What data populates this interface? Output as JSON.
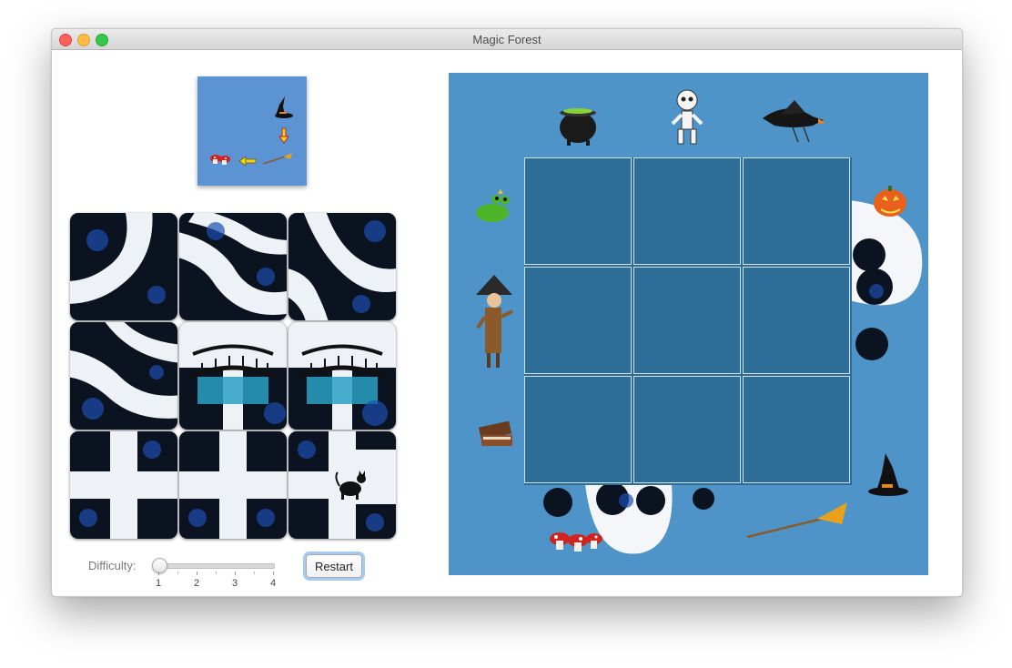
{
  "window": {
    "title": "Magic Forest"
  },
  "controls": {
    "difficulty_label": "Difficulty:",
    "difficulty_value": 1,
    "difficulty_ticks": [
      "1",
      "2",
      "3",
      "4"
    ],
    "restart_label": "Restart"
  },
  "preview": {
    "icons": [
      "witch-hat-icon",
      "arrow-down-icon",
      "broom-icon",
      "arrow-left-icon",
      "mushrooms-icon"
    ]
  },
  "tiles": [
    {
      "row": 1,
      "col": 1,
      "icon": "forest-path-tile"
    },
    {
      "row": 1,
      "col": 2,
      "icon": "forest-path-tile"
    },
    {
      "row": 1,
      "col": 3,
      "icon": "forest-path-tile"
    },
    {
      "row": 2,
      "col": 1,
      "icon": "forest-path-tile"
    },
    {
      "row": 2,
      "col": 2,
      "icon": "bridge-tile"
    },
    {
      "row": 2,
      "col": 3,
      "icon": "bridge-tile"
    },
    {
      "row": 3,
      "col": 1,
      "icon": "crossroad-tile"
    },
    {
      "row": 3,
      "col": 2,
      "icon": "crossroad-tile"
    },
    {
      "row": 3,
      "col": 3,
      "icon": "black-cat-tile"
    }
  ],
  "board": {
    "grid_rows": 3,
    "grid_cols": 3,
    "props": [
      "cauldron-icon",
      "skeleton-icon",
      "raven-icon",
      "frog-icon",
      "pumpkin-icon",
      "scarecrow-icon",
      "spellbook-icon",
      "witch-hat-icon",
      "mushrooms-icon",
      "broom-icon"
    ]
  },
  "colors": {
    "board_background": "#4e94c8",
    "grid_cell": "#2e6d97",
    "preview_background": "#5b93d3",
    "restart_focus": "#5aa0e6"
  }
}
